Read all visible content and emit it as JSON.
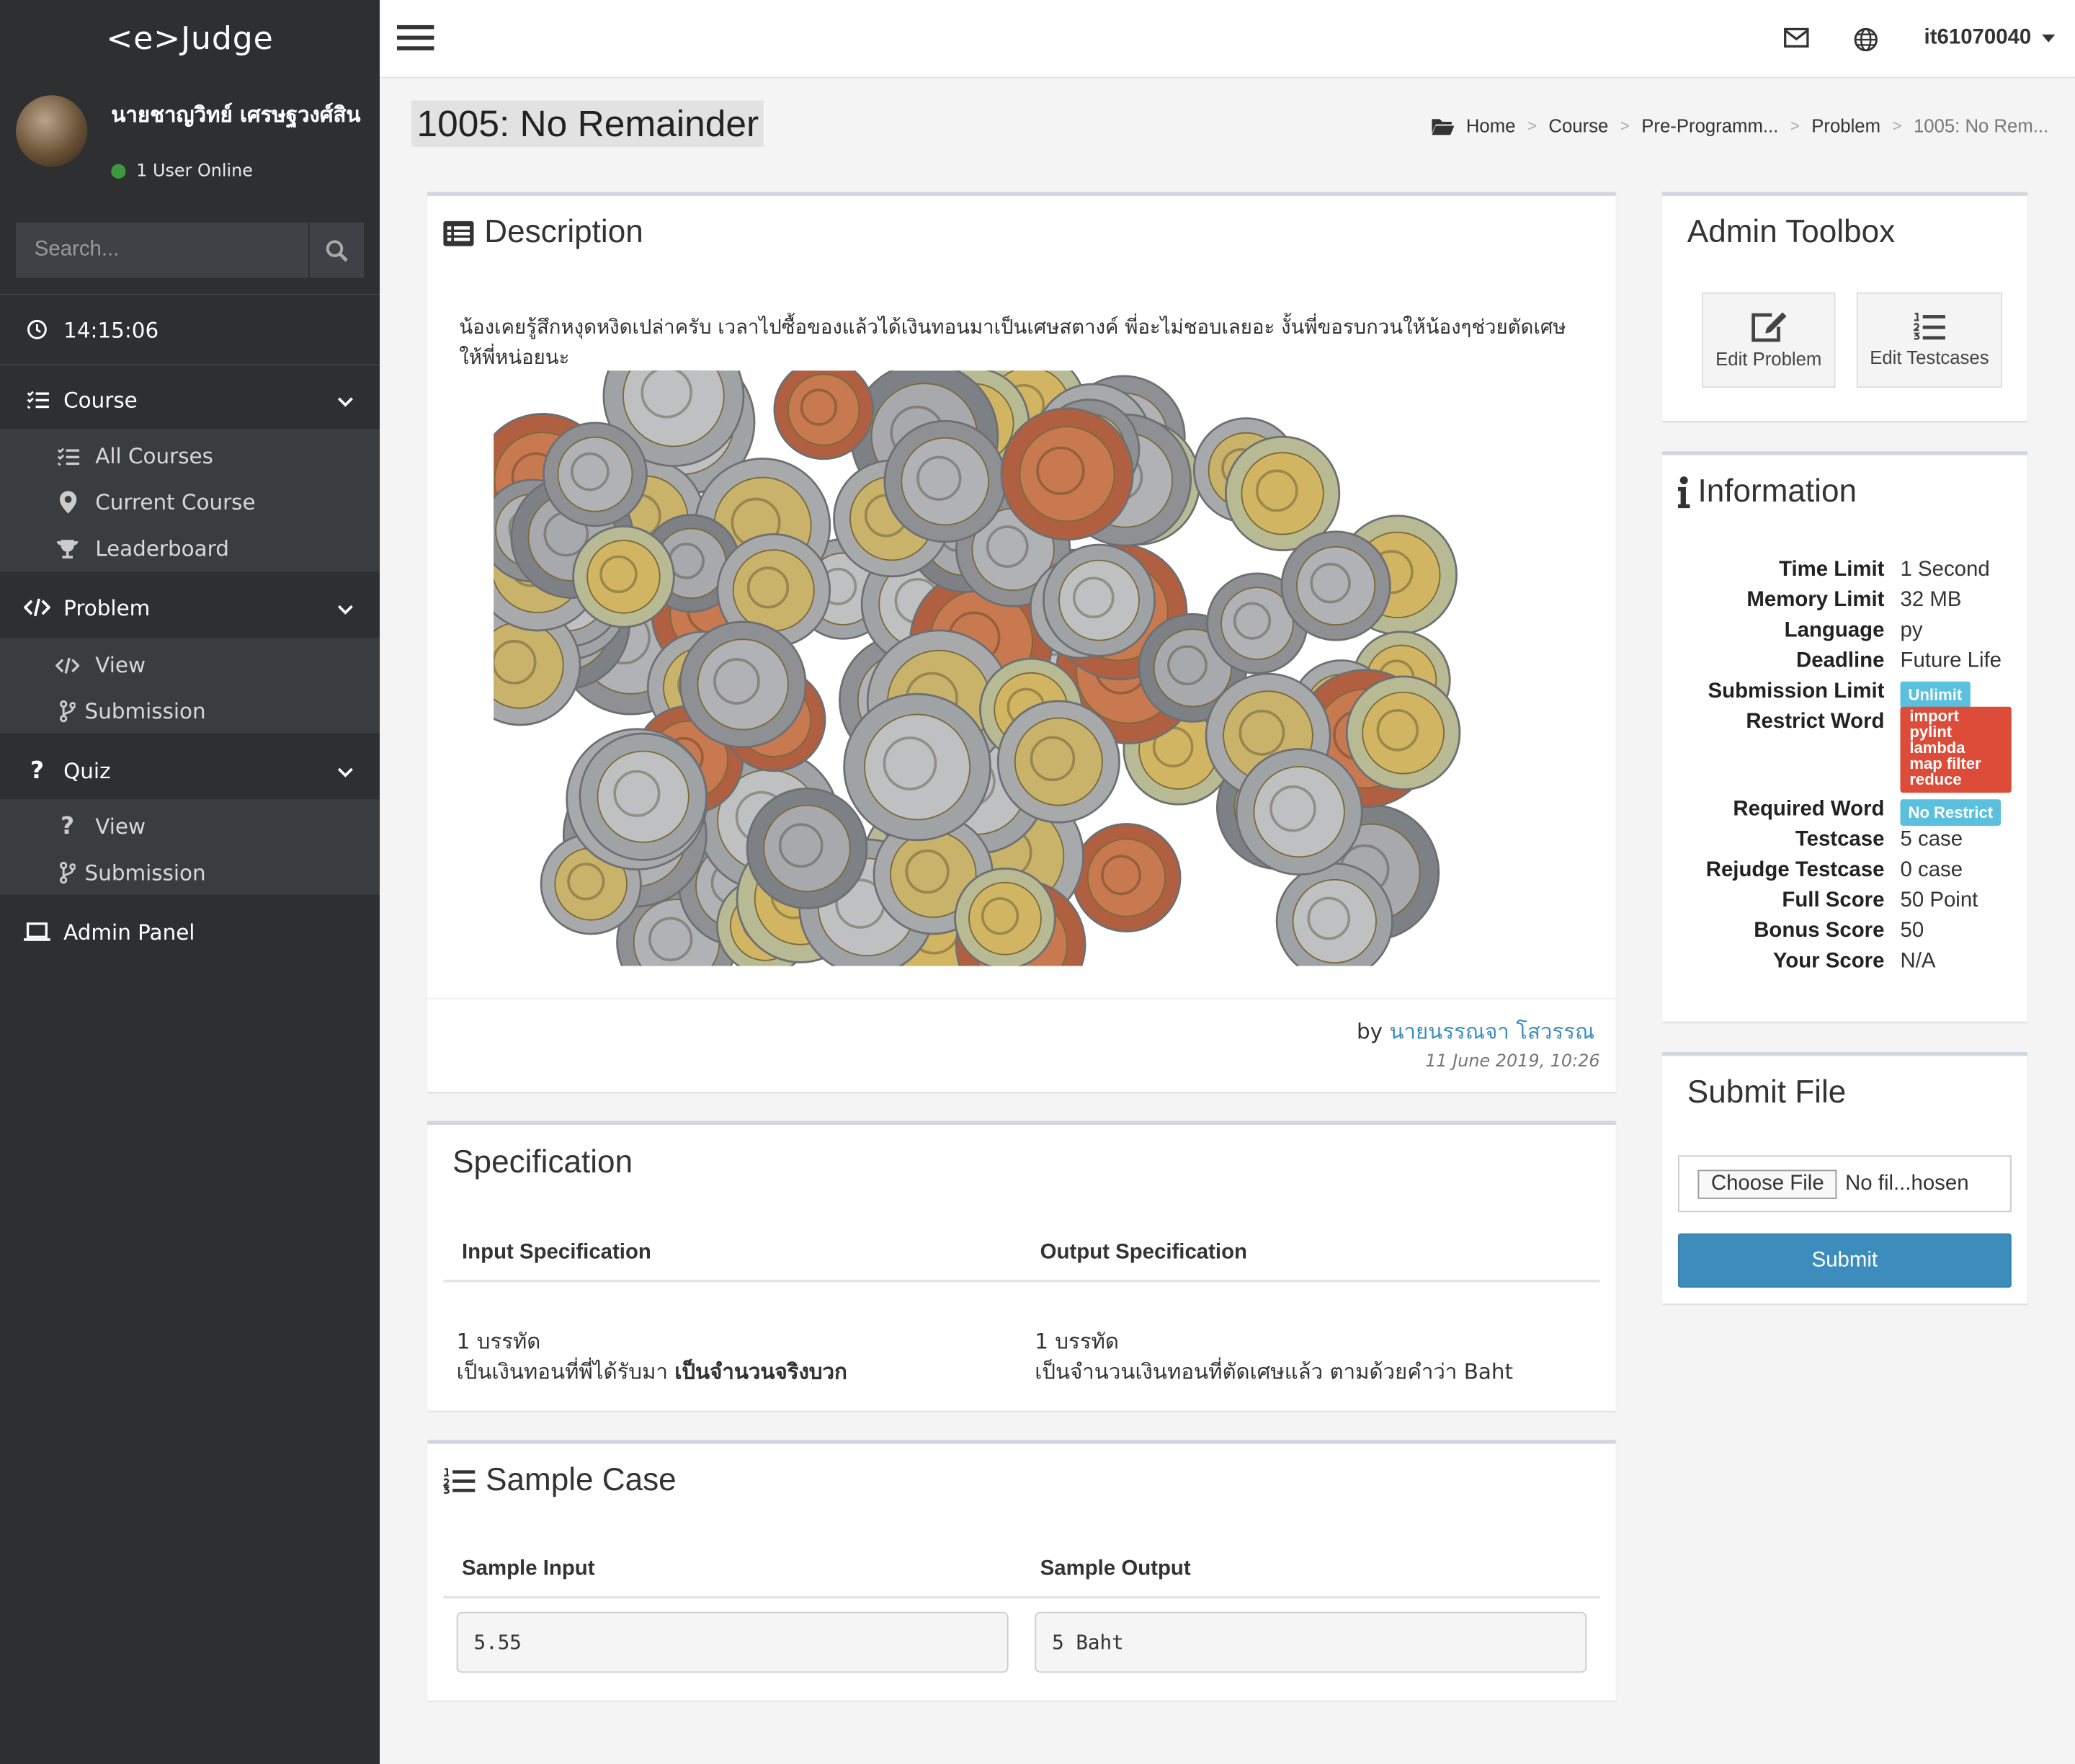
{
  "app": {
    "logo": "<e>Judge"
  },
  "user": {
    "name": "นายชาญวิทย์ เศรษฐวงศ์สิน",
    "status": "1 User Online",
    "account": "it61070040"
  },
  "search": {
    "placeholder": "Search..."
  },
  "clock": "14:15:06",
  "sidebar": {
    "course": {
      "label": "Course",
      "items": [
        "All Courses",
        "Current Course",
        "Leaderboard"
      ]
    },
    "problem": {
      "label": "Problem",
      "items": [
        "View",
        "Submission"
      ]
    },
    "quiz": {
      "label": "Quiz",
      "items": [
        "View",
        "Submission"
      ]
    },
    "admin": "Admin Panel"
  },
  "page": {
    "title": "1005: No Remainder"
  },
  "breadcrumb": [
    "Home",
    "Course",
    "Pre-Programm...",
    "Problem",
    "1005: No Rem..."
  ],
  "description": {
    "title": "Description",
    "text": "น้องเคยรู้สึกหงุดหงิดเปล่าครับ เวลาไปซื้อของแล้วได้เงินทอนมาเป็นเศษสตางค์ พี่อะไม่ชอบเลยอะ งั้นพี่ขอรบกวนให้น้องๆช่วยตัดเศษให้พี่หน่อยนะ",
    "by": "by",
    "author": "นายนรรณจา โสวรรณ",
    "date": "11 June 2019, 10:26"
  },
  "specification": {
    "title": "Specification",
    "input_header": "Input Specification",
    "output_header": "Output Specification",
    "input_line1": "1 บรรทัด",
    "input_line2": "เป็นเงินทอนที่พี่ได้รับมา",
    "input_line2_bold": "เป็นจำนวนจริงบวก",
    "output_line1": "1 บรรทัด",
    "output_line2": "เป็นจำนวนเงินทอนที่ตัดเศษแล้ว ตามด้วยคำว่า Baht"
  },
  "sample": {
    "title": "Sample Case",
    "input_header": "Sample Input",
    "output_header": "Sample Output",
    "input": "5.55",
    "output": "5 Baht"
  },
  "toolbox": {
    "title": "Admin Toolbox",
    "edit_problem": "Edit Problem",
    "edit_testcases": "Edit Testcases"
  },
  "information": {
    "title": "Information",
    "rows": {
      "time_limit": {
        "k": "Time Limit",
        "v": "1 Second"
      },
      "memory_limit": {
        "k": "Memory Limit",
        "v": "32 MB"
      },
      "language": {
        "k": "Language",
        "v": "py"
      },
      "deadline": {
        "k": "Deadline",
        "v": "Future Life"
      },
      "submission_limit": {
        "k": "Submission Limit",
        "v": "Unlimit"
      },
      "restrict_word": {
        "k": "Restrict Word",
        "v": [
          "import",
          "pylint",
          "lambda",
          "map filter",
          "reduce"
        ]
      },
      "required_word": {
        "k": "Required Word",
        "v": "No Restrict"
      },
      "testcase": {
        "k": "Testcase",
        "v": "5 case"
      },
      "rejudge": {
        "k": "Rejudge Testcase",
        "v": "0 case"
      },
      "full_score": {
        "k": "Full Score",
        "v": "50 Point"
      },
      "bonus_score": {
        "k": "Bonus Score",
        "v": "50"
      },
      "your_score": {
        "k": "Your Score",
        "v": "N/A"
      }
    }
  },
  "submit": {
    "title": "Submit File",
    "choose": "Choose File",
    "no_file": "No fil...hosen",
    "button": "Submit"
  },
  "colors": {
    "sidebar": "#2d2f31",
    "accent": "#3c8dbc",
    "badge_info": "#5bc0de",
    "badge_red": "#dd4b39"
  }
}
